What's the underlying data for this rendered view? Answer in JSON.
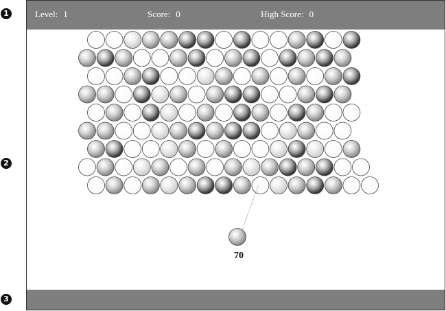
{
  "markers": [
    "1",
    "2",
    "3"
  ],
  "hud": {
    "level_label": "Level:",
    "level_value": "1",
    "score_label": "Score:",
    "score_value": "0",
    "high_label": "High Score:",
    "high_value": "0"
  },
  "shooter": {
    "ammo": "70",
    "current_shade": "mid"
  },
  "colors": {
    "bar": "#7e7e7e",
    "dark": "#3a3a3a",
    "mid": "#8f8f8f",
    "light": "#cfcfcf",
    "white": "#fafafa"
  },
  "grid": {
    "legend": "D = dark, M = mid, L = light, W = white",
    "rows": [
      "WWLMMDDWDWWMDWD",
      "MDMWWMDWMDWDMDM",
      "WWMDWWLMWMWMWMD",
      "MMWDLMWMDDWWMDM",
      "WMWDLWMWDMWDMWW",
      "MMWWLMDMDDWLMWW",
      "MDWWLMWMWWLDLWM",
      "WMWLMWMWMLMDMDWW",
      "WMWMLMDDMWLMDMWW"
    ]
  }
}
